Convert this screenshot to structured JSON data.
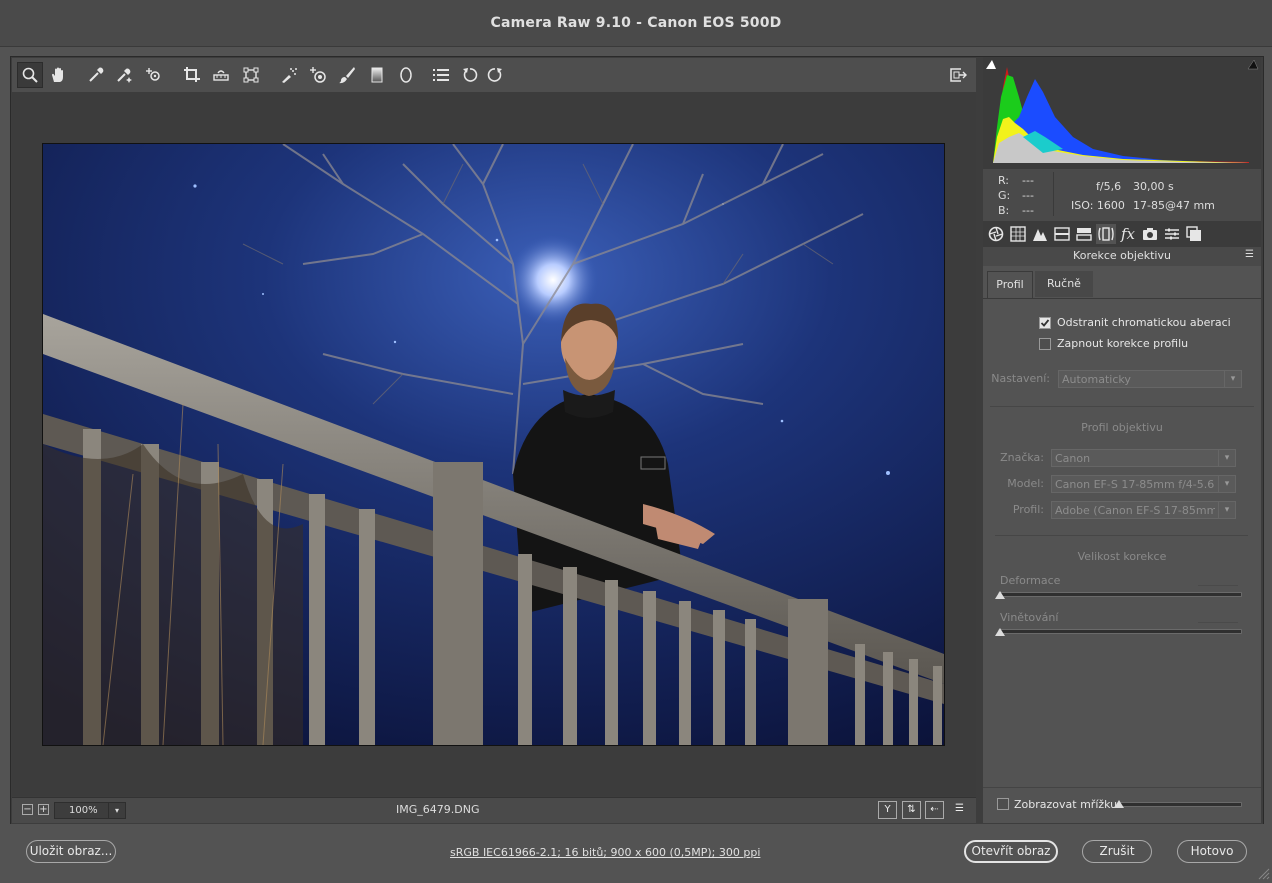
{
  "window": {
    "title": "Camera Raw 9.10  -  Canon EOS 500D"
  },
  "toolbar": {
    "tools": [
      "zoom-icon",
      "hand-icon",
      "white-balance-icon",
      "color-sampler-icon",
      "targeted-adjustment-icon",
      "crop-icon",
      "straighten-icon",
      "transform-icon",
      "spot-removal-icon",
      "red-eye-icon",
      "adjustment-brush-icon",
      "graduated-filter-icon",
      "radial-filter-icon",
      "preferences-icon",
      "rotate-left-icon",
      "rotate-right-icon"
    ],
    "fullscreen_icon": "toggle-fullscreen-icon"
  },
  "status": {
    "zoom_minus": "−",
    "zoom_plus": "+",
    "zoom_value": "100%",
    "filename": "IMG_6479.DNG",
    "view_y": "Y"
  },
  "info": {
    "r_label": "R:",
    "g_label": "G:",
    "b_label": "B:",
    "r_value": "---",
    "g_value": "---",
    "b_value": "---",
    "aperture": "f/5,6",
    "shutter": "30,00 s",
    "iso": "ISO: 1600",
    "lens": "17-85@47 mm"
  },
  "panel": {
    "title": "Korekce objektivu",
    "tabs": [
      {
        "label": "Profil",
        "active": true
      },
      {
        "label": "Ručně",
        "active": false
      }
    ],
    "remove_ca": {
      "label": "Odstranit chromatickou aberaci",
      "checked": true
    },
    "enable_profile": {
      "label": "Zapnout korekce profilu",
      "checked": false
    },
    "setup": {
      "label": "Nastavení:",
      "value": "Automaticky"
    },
    "lens_profile": {
      "heading": "Profil objektivu",
      "make_label": "Značka:",
      "make_value": "Canon",
      "model_label": "Model:",
      "model_value": "Canon EF-S 17-85mm f/4-5.6 ...",
      "profile_label": "Profil:",
      "profile_value": "Adobe (Canon EF-S 17-85mm ..."
    },
    "correction_amount": {
      "heading": "Velikost korekce",
      "distortion_label": "Deformace",
      "vignetting_label": "Vinětování"
    },
    "show_grid": {
      "label": "Zobrazovat mřížku",
      "checked": false
    }
  },
  "footer": {
    "save_label": "Uložit obraz...",
    "workflow_label": "sRGB IEC61966-2.1; 16 bitů; 900 x 600 (0,5MP); 300 ppi",
    "open_label": "Otevřít obraz",
    "cancel_label": "Zrušit",
    "done_label": "Hotovo"
  }
}
